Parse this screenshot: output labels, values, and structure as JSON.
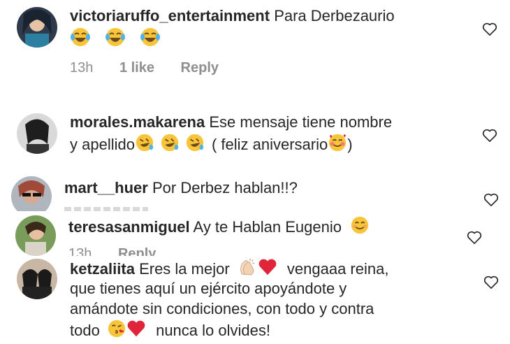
{
  "comments": [
    {
      "username": "victoriaruffo_entertainment",
      "text": "Para Derbezaurio",
      "emojis": [
        "laughing-tears",
        "laughing-tears",
        "laughing-tears"
      ],
      "time": "13h",
      "likes": "1 like",
      "reply": "Reply"
    },
    {
      "username": "morales.makarena",
      "text_line1": "Ese mensaje tiene nombre",
      "text_line2_a": "y apellido",
      "text_line2_b": "( feliz  aniversario",
      "text_line2_c": ")"
    },
    {
      "username": "mart__huer",
      "text": "Por Derbez hablan!!?"
    },
    {
      "username": "teresasanmiguel",
      "text": "Ay te Hablan Eugenio",
      "time": "13h",
      "reply": "Reply"
    },
    {
      "username": "ketzaliita",
      "text_line1_a": "Eres la mejor",
      "text_line1_b": "vengaaa reina,",
      "text_line2": "que tienes aquí un ejército apoyándote y",
      "text_line3": "amándote sin condiciones, con todo y contra",
      "text_line4_a": "todo",
      "text_line4_b": "nunca lo olvides!"
    }
  ],
  "icons": {
    "like": "heart-outline-icon",
    "laugh": "laughing-tears-emoji",
    "rofl": "rolling-laughing-emoji",
    "love": "smiling-hearts-emoji",
    "blush": "smiling-emoji",
    "clap": "clapping-hands-emoji",
    "heart": "red-heart-emoji",
    "kiss": "blowing-kiss-emoji"
  },
  "colors": {
    "text": "#262626",
    "meta": "#8e8e8e",
    "heart_red": "#e0243a",
    "emoji_yellow": "#f8c53a"
  }
}
